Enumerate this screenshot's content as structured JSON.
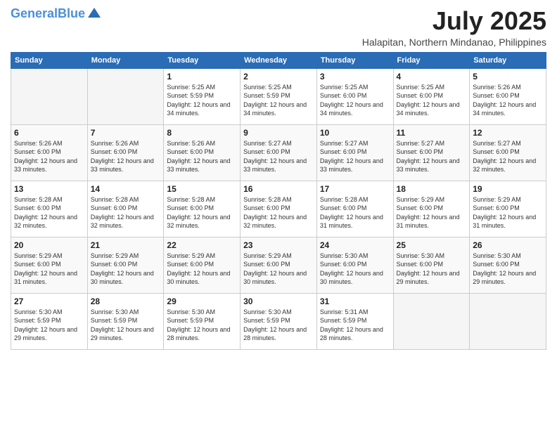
{
  "header": {
    "logo_line1": "General",
    "logo_line2": "Blue",
    "month": "July 2025",
    "location": "Halapitan, Northern Mindanao, Philippines"
  },
  "weekdays": [
    "Sunday",
    "Monday",
    "Tuesday",
    "Wednesday",
    "Thursday",
    "Friday",
    "Saturday"
  ],
  "weeks": [
    [
      {
        "day": "",
        "sunrise": "",
        "sunset": "",
        "daylight": "",
        "empty": true
      },
      {
        "day": "",
        "sunrise": "",
        "sunset": "",
        "daylight": "",
        "empty": true
      },
      {
        "day": "1",
        "sunrise": "Sunrise: 5:25 AM",
        "sunset": "Sunset: 5:59 PM",
        "daylight": "Daylight: 12 hours and 34 minutes.",
        "empty": false
      },
      {
        "day": "2",
        "sunrise": "Sunrise: 5:25 AM",
        "sunset": "Sunset: 5:59 PM",
        "daylight": "Daylight: 12 hours and 34 minutes.",
        "empty": false
      },
      {
        "day": "3",
        "sunrise": "Sunrise: 5:25 AM",
        "sunset": "Sunset: 6:00 PM",
        "daylight": "Daylight: 12 hours and 34 minutes.",
        "empty": false
      },
      {
        "day": "4",
        "sunrise": "Sunrise: 5:25 AM",
        "sunset": "Sunset: 6:00 PM",
        "daylight": "Daylight: 12 hours and 34 minutes.",
        "empty": false
      },
      {
        "day": "5",
        "sunrise": "Sunrise: 5:26 AM",
        "sunset": "Sunset: 6:00 PM",
        "daylight": "Daylight: 12 hours and 34 minutes.",
        "empty": false
      }
    ],
    [
      {
        "day": "6",
        "sunrise": "Sunrise: 5:26 AM",
        "sunset": "Sunset: 6:00 PM",
        "daylight": "Daylight: 12 hours and 33 minutes.",
        "empty": false
      },
      {
        "day": "7",
        "sunrise": "Sunrise: 5:26 AM",
        "sunset": "Sunset: 6:00 PM",
        "daylight": "Daylight: 12 hours and 33 minutes.",
        "empty": false
      },
      {
        "day": "8",
        "sunrise": "Sunrise: 5:26 AM",
        "sunset": "Sunset: 6:00 PM",
        "daylight": "Daylight: 12 hours and 33 minutes.",
        "empty": false
      },
      {
        "day": "9",
        "sunrise": "Sunrise: 5:27 AM",
        "sunset": "Sunset: 6:00 PM",
        "daylight": "Daylight: 12 hours and 33 minutes.",
        "empty": false
      },
      {
        "day": "10",
        "sunrise": "Sunrise: 5:27 AM",
        "sunset": "Sunset: 6:00 PM",
        "daylight": "Daylight: 12 hours and 33 minutes.",
        "empty": false
      },
      {
        "day": "11",
        "sunrise": "Sunrise: 5:27 AM",
        "sunset": "Sunset: 6:00 PM",
        "daylight": "Daylight: 12 hours and 33 minutes.",
        "empty": false
      },
      {
        "day": "12",
        "sunrise": "Sunrise: 5:27 AM",
        "sunset": "Sunset: 6:00 PM",
        "daylight": "Daylight: 12 hours and 32 minutes.",
        "empty": false
      }
    ],
    [
      {
        "day": "13",
        "sunrise": "Sunrise: 5:28 AM",
        "sunset": "Sunset: 6:00 PM",
        "daylight": "Daylight: 12 hours and 32 minutes.",
        "empty": false
      },
      {
        "day": "14",
        "sunrise": "Sunrise: 5:28 AM",
        "sunset": "Sunset: 6:00 PM",
        "daylight": "Daylight: 12 hours and 32 minutes.",
        "empty": false
      },
      {
        "day": "15",
        "sunrise": "Sunrise: 5:28 AM",
        "sunset": "Sunset: 6:00 PM",
        "daylight": "Daylight: 12 hours and 32 minutes.",
        "empty": false
      },
      {
        "day": "16",
        "sunrise": "Sunrise: 5:28 AM",
        "sunset": "Sunset: 6:00 PM",
        "daylight": "Daylight: 12 hours and 32 minutes.",
        "empty": false
      },
      {
        "day": "17",
        "sunrise": "Sunrise: 5:28 AM",
        "sunset": "Sunset: 6:00 PM",
        "daylight": "Daylight: 12 hours and 31 minutes.",
        "empty": false
      },
      {
        "day": "18",
        "sunrise": "Sunrise: 5:29 AM",
        "sunset": "Sunset: 6:00 PM",
        "daylight": "Daylight: 12 hours and 31 minutes.",
        "empty": false
      },
      {
        "day": "19",
        "sunrise": "Sunrise: 5:29 AM",
        "sunset": "Sunset: 6:00 PM",
        "daylight": "Daylight: 12 hours and 31 minutes.",
        "empty": false
      }
    ],
    [
      {
        "day": "20",
        "sunrise": "Sunrise: 5:29 AM",
        "sunset": "Sunset: 6:00 PM",
        "daylight": "Daylight: 12 hours and 31 minutes.",
        "empty": false
      },
      {
        "day": "21",
        "sunrise": "Sunrise: 5:29 AM",
        "sunset": "Sunset: 6:00 PM",
        "daylight": "Daylight: 12 hours and 30 minutes.",
        "empty": false
      },
      {
        "day": "22",
        "sunrise": "Sunrise: 5:29 AM",
        "sunset": "Sunset: 6:00 PM",
        "daylight": "Daylight: 12 hours and 30 minutes.",
        "empty": false
      },
      {
        "day": "23",
        "sunrise": "Sunrise: 5:29 AM",
        "sunset": "Sunset: 6:00 PM",
        "daylight": "Daylight: 12 hours and 30 minutes.",
        "empty": false
      },
      {
        "day": "24",
        "sunrise": "Sunrise: 5:30 AM",
        "sunset": "Sunset: 6:00 PM",
        "daylight": "Daylight: 12 hours and 30 minutes.",
        "empty": false
      },
      {
        "day": "25",
        "sunrise": "Sunrise: 5:30 AM",
        "sunset": "Sunset: 6:00 PM",
        "daylight": "Daylight: 12 hours and 29 minutes.",
        "empty": false
      },
      {
        "day": "26",
        "sunrise": "Sunrise: 5:30 AM",
        "sunset": "Sunset: 6:00 PM",
        "daylight": "Daylight: 12 hours and 29 minutes.",
        "empty": false
      }
    ],
    [
      {
        "day": "27",
        "sunrise": "Sunrise: 5:30 AM",
        "sunset": "Sunset: 5:59 PM",
        "daylight": "Daylight: 12 hours and 29 minutes.",
        "empty": false
      },
      {
        "day": "28",
        "sunrise": "Sunrise: 5:30 AM",
        "sunset": "Sunset: 5:59 PM",
        "daylight": "Daylight: 12 hours and 29 minutes.",
        "empty": false
      },
      {
        "day": "29",
        "sunrise": "Sunrise: 5:30 AM",
        "sunset": "Sunset: 5:59 PM",
        "daylight": "Daylight: 12 hours and 28 minutes.",
        "empty": false
      },
      {
        "day": "30",
        "sunrise": "Sunrise: 5:30 AM",
        "sunset": "Sunset: 5:59 PM",
        "daylight": "Daylight: 12 hours and 28 minutes.",
        "empty": false
      },
      {
        "day": "31",
        "sunrise": "Sunrise: 5:31 AM",
        "sunset": "Sunset: 5:59 PM",
        "daylight": "Daylight: 12 hours and 28 minutes.",
        "empty": false
      },
      {
        "day": "",
        "sunrise": "",
        "sunset": "",
        "daylight": "",
        "empty": true
      },
      {
        "day": "",
        "sunrise": "",
        "sunset": "",
        "daylight": "",
        "empty": true
      }
    ]
  ]
}
